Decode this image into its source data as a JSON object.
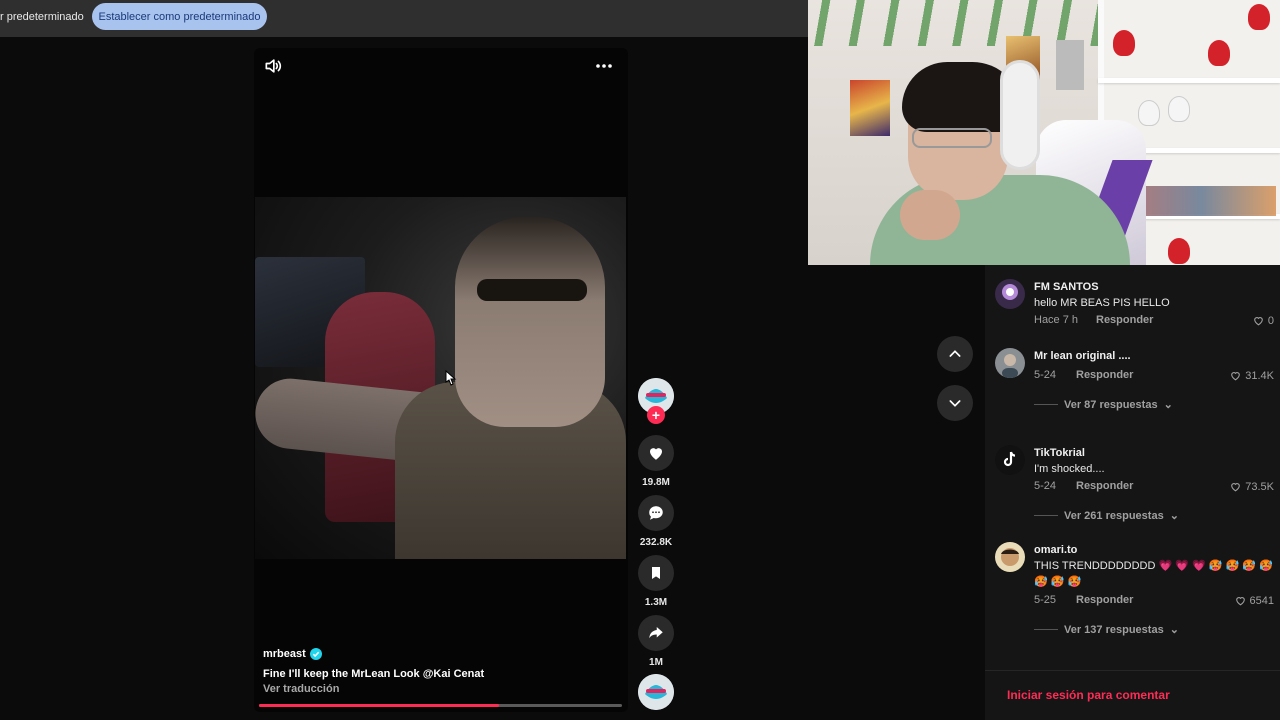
{
  "banner": {
    "text": "r predeterminado",
    "button_label": "Establecer como predeterminado"
  },
  "video": {
    "author": "mrbeast",
    "caption": "Fine I'll keep the MrLean Look @Kai Cenat",
    "translate_label": "Ver traducción",
    "progress": 0.66,
    "actions": {
      "likes": "19.8M",
      "comments": "232.8K",
      "saves": "1.3M",
      "shares": "1M"
    }
  },
  "comments": [
    {
      "user": "FM SANTOS",
      "text": "hello MR BEAS PIS HELLO",
      "time": "Hace 7 h",
      "reply_label": "Responder",
      "likes": "0",
      "views": ""
    },
    {
      "user": "",
      "text": "Mr lean original ....",
      "time": "5-24",
      "reply_label": "Responder",
      "likes": "31.4K",
      "views": "Ver 87 respuestas"
    },
    {
      "user": "TikTokrial",
      "text": "I'm shocked....",
      "time": "5-24",
      "reply_label": "Responder",
      "likes": "73.5K",
      "views": "Ver 261 respuestas"
    },
    {
      "user": "omari.to",
      "text": "THIS TRENDDDDDDDD 💗 💗 💗 🥵 🥵 🥵 🥵 🥵 🥵 🥵",
      "time": "5-25",
      "reply_label": "Responder",
      "likes": "6541",
      "views": "Ver 137 respuestas"
    }
  ],
  "login_label": "Iniciar sesión para comentar",
  "colors": {
    "accent": "#fe2c55",
    "banner_button": "#a9c3ef",
    "verified": "#20d5ec"
  }
}
